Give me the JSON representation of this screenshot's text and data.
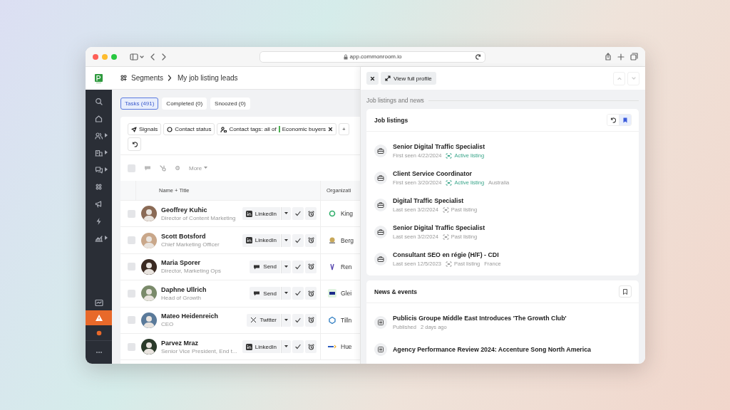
{
  "browser": {
    "url": "app.commonroom.io"
  },
  "breadcrumb": [
    "Segments",
    "My job listing leads"
  ],
  "sidebar": {
    "items": [
      {
        "submenu": false
      },
      {
        "submenu": false
      },
      {
        "submenu": true
      },
      {
        "submenu": true
      },
      {
        "submenu": true
      },
      {
        "submenu": false
      },
      {
        "submenu": false
      },
      {
        "submenu": false
      },
      {
        "submenu": true
      }
    ],
    "bottom": [
      {
        "selected": false
      },
      {
        "selected": true
      },
      {
        "selected": false
      },
      {
        "selected": false
      }
    ]
  },
  "tabs": [
    {
      "label": "Tasks (491)",
      "selected": true
    },
    {
      "label": "Completed (0)",
      "selected": false
    },
    {
      "label": "Snoozed (0)",
      "selected": false
    }
  ],
  "filters": [
    {
      "kind": "signals",
      "label": "Signals"
    },
    {
      "kind": "status",
      "label": "Contact status"
    },
    {
      "kind": "tags",
      "label": "Contact tags: all of",
      "tag": "Economic buyers",
      "color": "#4caf50"
    },
    {
      "kind": "add",
      "label": "+"
    }
  ],
  "toolbar": {
    "select_all_checked": false,
    "more": "More"
  },
  "table": {
    "columns": [
      "Name + Title",
      "Organizati"
    ],
    "rows": [
      {
        "name": "Geoffrey Kuhic",
        "title": "Director of Content Marketing",
        "action": {
          "kind": "linkedin",
          "label": "LinkedIn"
        },
        "org": "King",
        "checked": false
      },
      {
        "name": "Scott Botsford",
        "title": "Chief Marketing Officer",
        "action": {
          "kind": "linkedin",
          "label": "LinkedIn"
        },
        "org": "Berg",
        "checked": false
      },
      {
        "name": "Maria Sporer",
        "title": "Director, Marketing Ops",
        "action": {
          "kind": "send",
          "label": "Send"
        },
        "org": "Ren",
        "checked": false
      },
      {
        "name": "Daphne Ullrich",
        "title": "Head of Growth",
        "action": {
          "kind": "send",
          "label": "Send"
        },
        "org": "Glei",
        "checked": false
      },
      {
        "name": "Mateo Heidenreich",
        "title": "CEO",
        "action": {
          "kind": "twitter",
          "label": "Twitter"
        },
        "org": "Tilln",
        "checked": false
      },
      {
        "name": "Parvez Mraz",
        "title": "Senior Vice President, End t...",
        "action": {
          "kind": "linkedin",
          "label": "LinkedIn"
        },
        "org": "Hue",
        "checked": false
      }
    ]
  },
  "panel": {
    "view_profile": "View full profile",
    "section": "Job listings and news",
    "job_listings": {
      "title": "Job listings",
      "bookmarked": true,
      "items": [
        {
          "title": "Senior Digital Traffic Specialist",
          "seen": "First seen 4/22/2024",
          "status": "Active listing",
          "active": true
        },
        {
          "title": "Client Service Coordinator",
          "seen": "First seen 3/20/2024",
          "status": "Active listing",
          "active": true,
          "location": "Australia"
        },
        {
          "title": "Digital Traffic Specialist",
          "seen": "Last seen 3/2/2024",
          "status": "Past listing",
          "active": false
        },
        {
          "title": "Senior Digital Traffic Specialist",
          "seen": "Last seen 3/2/2024",
          "status": "Past listing",
          "active": false
        },
        {
          "title": "Consultant SEO en régie (H/F) - CDI",
          "seen": "Last seen 12/5/2023",
          "status": "Past listing",
          "active": false,
          "location": "France"
        }
      ]
    },
    "news": {
      "title": "News & events",
      "bookmarked": false,
      "items": [
        {
          "title": "Publicis Groupe Middle East Introduces 'The Growth Club'",
          "meta": [
            "Published",
            "2 days ago"
          ]
        },
        {
          "title": "Agency Performance Review 2024: Accenture Song North America"
        }
      ]
    }
  }
}
